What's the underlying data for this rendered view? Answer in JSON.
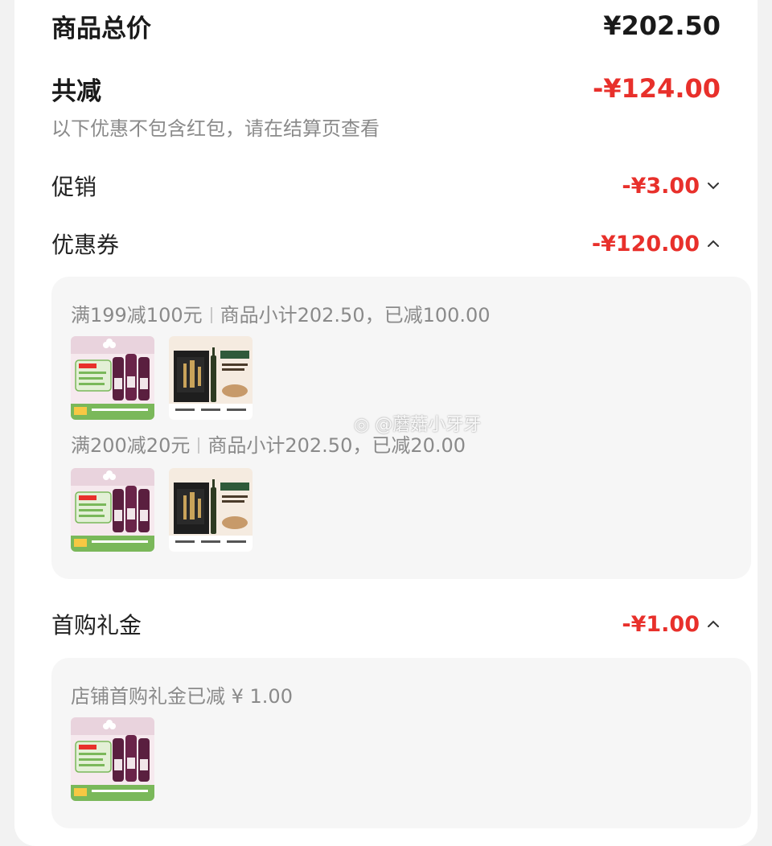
{
  "summary": {
    "total_label": "商品总价",
    "total_value": "¥202.50",
    "discount_label": "共减",
    "discount_value": "-¥124.00",
    "note": "以下优惠不包含红包，请在结算页查看"
  },
  "promotion": {
    "label": "促销",
    "value": "-¥3.00",
    "chevron": "chevron-down-icon"
  },
  "coupons": {
    "label": "优惠券",
    "value": "-¥120.00",
    "chevron": "chevron-up-icon",
    "rules": [
      {
        "title": "满199减100元",
        "detail": "商品小计202.50，已减100.00",
        "products": [
          "grape-juice-product",
          "olive-oil-product"
        ]
      },
      {
        "title": "满200减20元",
        "detail": "商品小计202.50，已减20.00",
        "products": [
          "grape-juice-product",
          "olive-oil-product"
        ]
      }
    ]
  },
  "first_purchase": {
    "label": "首购礼金",
    "value": "-¥1.00",
    "chevron": "chevron-up-icon",
    "detail": "店铺首购礼金已减 ¥ 1.00",
    "products": [
      "grape-juice-product"
    ]
  },
  "watermark": "@蘑菇小牙牙",
  "colors": {
    "accent_red": "#e8302b",
    "muted_text": "#8a8a8a",
    "panel_bg": "#f6f6f6"
  }
}
